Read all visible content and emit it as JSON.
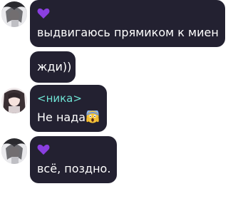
{
  "messages": [
    {
      "sender_icon": "purple-heart-icon",
      "text": "выдвигаюсь прямиком к миен"
    },
    {
      "text": "жди))"
    },
    {
      "sender_name": "<ника>",
      "text": "Не нада",
      "emoji": "screaming-face-icon"
    },
    {
      "sender_icon": "purple-heart-icon",
      "text": "всё, поздно."
    }
  ],
  "colors": {
    "bubble": "#232131",
    "text": "#ffffff",
    "name": "#6fe3d4",
    "heart": "#8a3fe0"
  }
}
